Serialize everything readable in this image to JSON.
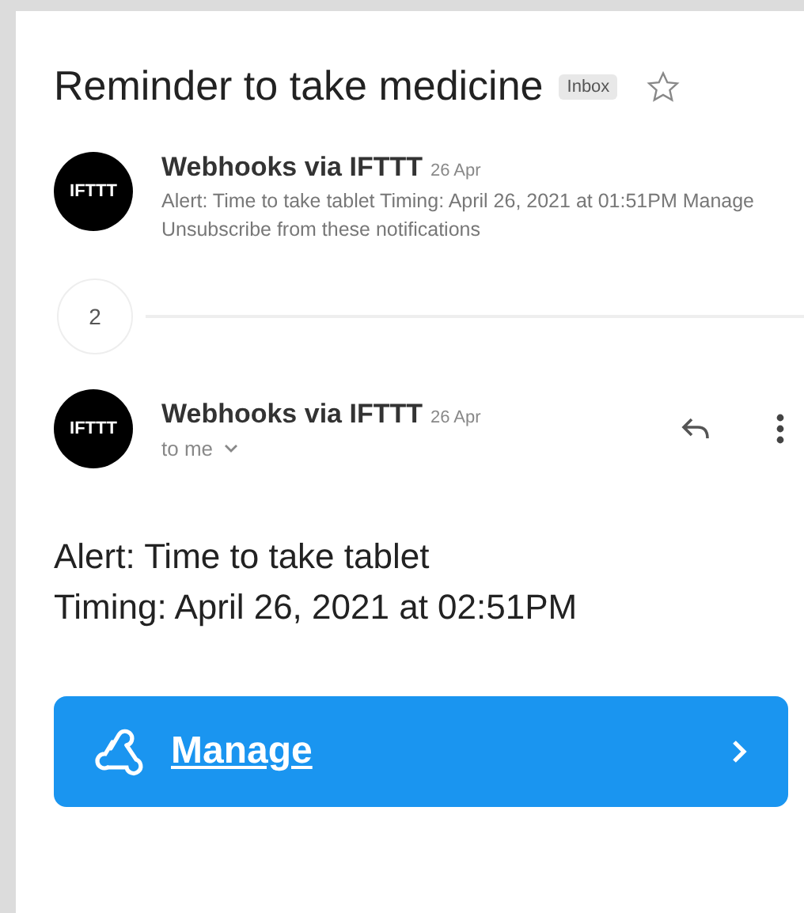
{
  "subject": {
    "title": "Reminder to take medicine",
    "label": "Inbox",
    "starred": false
  },
  "collapsed_message": {
    "avatar": "IFTTT",
    "sender": "Webhooks via IFTTT",
    "date": "26 Apr",
    "snippet": "Alert: Time to take tablet Timing: April 26, 2021 at 01:51PM Manage Unsubscribe from these notifications"
  },
  "hidden_count": "2",
  "open_message": {
    "avatar": "IFTTT",
    "sender": "Webhooks via IFTTT",
    "date": "26 Apr",
    "recipient": "to me",
    "body": [
      "Alert: Time to take tablet",
      "Timing: April 26, 2021 at 02:51PM"
    ],
    "button": "Manage"
  }
}
